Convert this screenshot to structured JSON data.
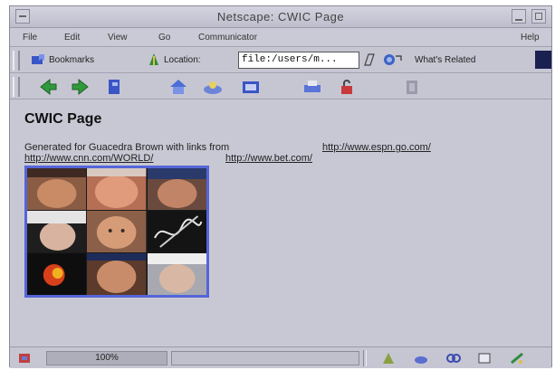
{
  "window": {
    "title": "Netscape: CWIC Page"
  },
  "menu": {
    "file": "File",
    "edit": "Edit",
    "view": "View",
    "go": "Go",
    "communicator": "Communicator",
    "help": "Help"
  },
  "locbar": {
    "bookmarks_label": "Bookmarks",
    "location_label": "Location:",
    "url": "file:/users/m...",
    "related_label": "What's Related"
  },
  "toolbar": {
    "icons": [
      "back-icon",
      "forward-icon",
      "reload-icon",
      "home-icon",
      "search-icon",
      "guide-icon",
      "print-icon",
      "security-icon",
      "stop-icon"
    ]
  },
  "page": {
    "title": "CWIC Page",
    "generated_text": "Generated for Guacedra Brown with links from",
    "links": [
      "http://www.espn.go.com/",
      "http://www.cnn.com/WORLD/",
      "http://www.bet.com/"
    ]
  },
  "status": {
    "progress_text": "100%",
    "progress_value": 1.0
  },
  "colors": {
    "mosaic_border": "#5565d8",
    "chrome": "#c6c6d3"
  }
}
